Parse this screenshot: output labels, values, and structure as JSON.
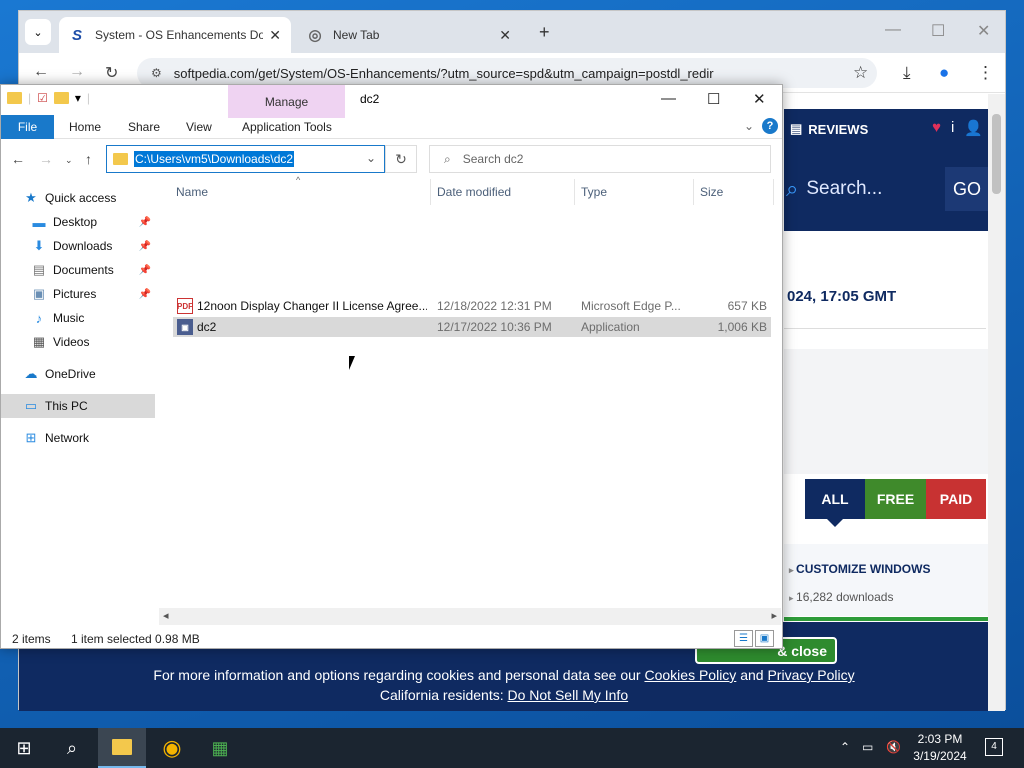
{
  "browser": {
    "tabs": [
      {
        "title": "System - OS Enhancements Do",
        "favicon": "S",
        "close": "✕"
      },
      {
        "title": "New Tab",
        "close": "✕"
      }
    ],
    "new_tab": "+",
    "url": "softpedia.com/get/System/OS-Enhancements/?utm_source=spd&utm_campaign=postdl_redir"
  },
  "page": {
    "reviews": "REVIEWS",
    "search_placeholder": "Search...",
    "go": "GO",
    "date": "024, 17:05 GMT",
    "tabs": [
      "ALL",
      "FREE",
      "PAID"
    ],
    "tab_colors": [
      "#0f2a61",
      "#3f8a2b",
      "#c83232"
    ],
    "category": "CUSTOMIZE WINDOWS",
    "downloads": "16,282 downloads",
    "accept": "& close",
    "cookie_line1_pre": "For more information and options regarding cookies and personal data see our",
    "cookie_policy": "Cookies Policy",
    "cookie_and": "and",
    "privacy_policy": "Privacy Policy",
    "cookie_line2_pre": "California residents:",
    "do_not_sell": "Do Not Sell My Info"
  },
  "explorer": {
    "manage": "Manage",
    "window_name": "dc2",
    "ribbon": {
      "file": "File",
      "home": "Home",
      "share": "Share",
      "view": "View",
      "app_tools": "Application Tools"
    },
    "address": "C:\\Users\\vm5\\Downloads\\dc2",
    "search_placeholder": "Search dc2",
    "nav": {
      "quick_access": "Quick access",
      "desktop": "Desktop",
      "downloads": "Downloads",
      "documents": "Documents",
      "pictures": "Pictures",
      "music": "Music",
      "videos": "Videos",
      "onedrive": "OneDrive",
      "this_pc": "This PC",
      "network": "Network"
    },
    "columns": {
      "name": "Name",
      "date": "Date modified",
      "type": "Type",
      "size": "Size"
    },
    "files": [
      {
        "name": "12noon Display Changer II License Agree...",
        "date": "12/18/2022 12:31 PM",
        "type": "Microsoft Edge P...",
        "size": "657 KB",
        "icon": "PDF"
      },
      {
        "name": "dc2",
        "date": "12/17/2022 10:36 PM",
        "type": "Application",
        "size": "1,006 KB",
        "icon": "app"
      }
    ],
    "status": {
      "items": "2 items",
      "selected": "1 item selected  0.98 MB"
    }
  },
  "taskbar": {
    "time": "2:03 PM",
    "date": "3/19/2024",
    "notifications": "4"
  }
}
